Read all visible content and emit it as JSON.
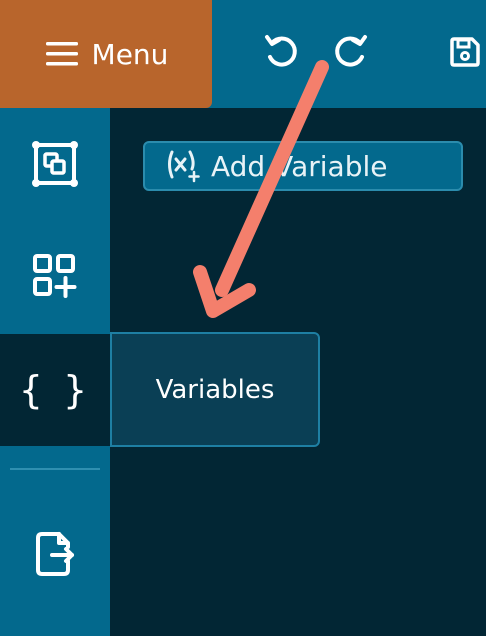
{
  "header": {
    "menu_label": "Menu",
    "icons": [
      "menu-icon",
      "undo-icon",
      "redo-icon",
      "save-icon"
    ]
  },
  "sidebar": {
    "items": [
      {
        "icon": "layers-icon"
      },
      {
        "icon": "add-widget-icon"
      },
      {
        "icon": "variables-icon",
        "glyph": "{ }",
        "active": true
      },
      {
        "icon": "export-file-icon"
      }
    ]
  },
  "main": {
    "add_variable_label": "Add Variable"
  },
  "tooltip": {
    "label": "Variables"
  },
  "colors": {
    "background": "#022634",
    "bar": "#03698d",
    "menu": "#b8652c",
    "annotation_arrow": "#f47f6c"
  }
}
